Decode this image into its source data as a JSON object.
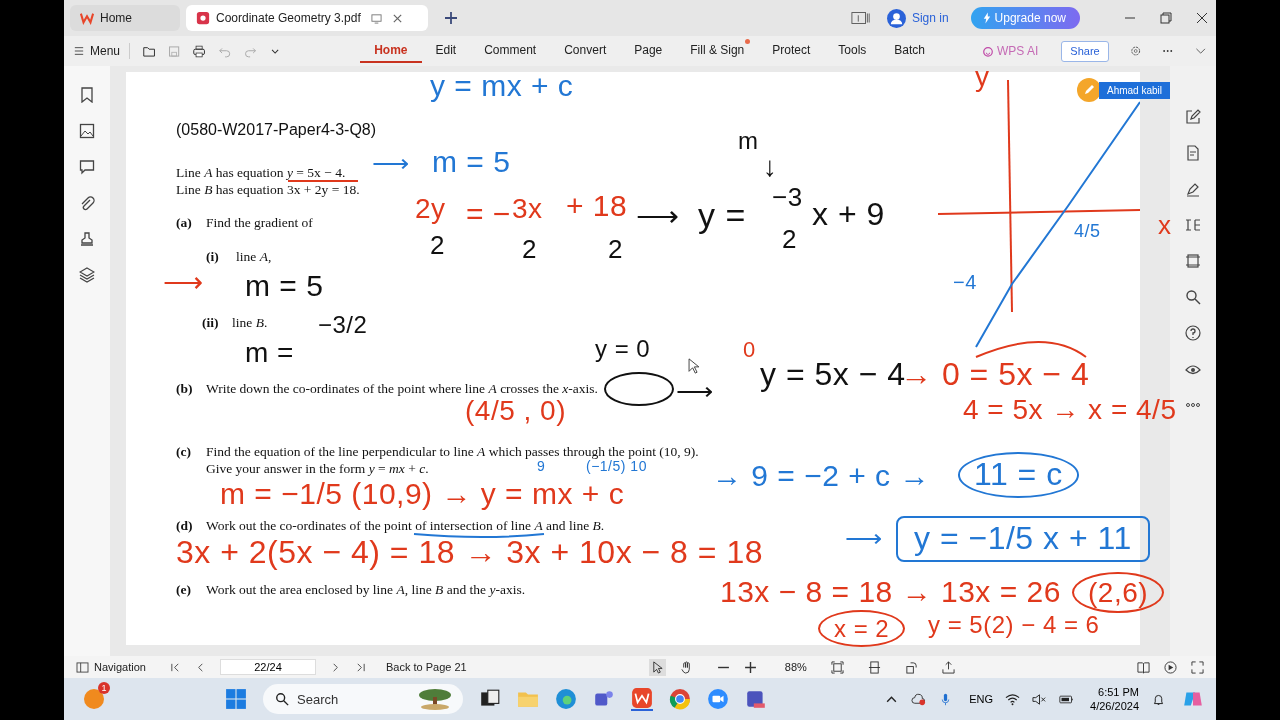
{
  "tabs": [
    {
      "label": "Home",
      "selected": false
    },
    {
      "label": "Coordinate Geometry 3.pdf",
      "selected": true
    }
  ],
  "account": {
    "sign_in": "Sign in",
    "upgrade": "Upgrade now"
  },
  "toolbar": {
    "menu": "Menu",
    "ribbon": [
      {
        "label": "Home",
        "selected": true,
        "dot": false
      },
      {
        "label": "Edit",
        "selected": false,
        "dot": false
      },
      {
        "label": "Comment",
        "selected": false,
        "dot": false
      },
      {
        "label": "Convert",
        "selected": false,
        "dot": false
      },
      {
        "label": "Page",
        "selected": false,
        "dot": false
      },
      {
        "label": "Fill & Sign",
        "selected": false,
        "dot": true
      },
      {
        "label": "Protect",
        "selected": false,
        "dot": false
      },
      {
        "label": "Tools",
        "selected": false,
        "dot": false
      },
      {
        "label": "Batch",
        "selected": false,
        "dot": false
      }
    ],
    "ai": "WPS AI",
    "share": "Share"
  },
  "document": {
    "heading": "(0580-W2017-Paper4-3-Q8)",
    "lines": [
      {
        "text": "Line *A* has equation  *y* = 5x − 4."
      },
      {
        "text": "Line *B* has equation  3x + 2y = 18."
      },
      {
        "label": "(a)",
        "text": "Find the gradient of"
      },
      {
        "label": "(i)",
        "text": "line *A*,"
      },
      {
        "label": "(ii)",
        "text": "line *B*."
      },
      {
        "label": "(b)",
        "text": "Write down the co-ordinates of the point where line *A* crosses the *x*-axis."
      },
      {
        "label": "(c)",
        "text": "Find the equation of the line perpendicular to line *A* which passes through the point (10, 9).\nGive your answer in the form  *y* = *mx* + *c*."
      },
      {
        "label": "(d)",
        "text": "Work out the co-ordinates of the point of intersection of line *A* and line *B*."
      },
      {
        "label": "(e)",
        "text": "Work out the area enclosed by line *A*, line *B* and the *y*-axis."
      }
    ],
    "annotations": [
      {
        "text": "y = mx + c",
        "color": "#2277d4",
        "kind": "plain"
      },
      {
        "text": "y",
        "color": "#e0391c",
        "kind": "plain"
      },
      {
        "text": "m",
        "color": "#111111",
        "kind": "plain"
      },
      {
        "text": "⟶",
        "color": "#2277d4",
        "kind": "plain"
      },
      {
        "text": "m = 5",
        "color": "#2277d4",
        "kind": "plain"
      },
      {
        "text": "↓",
        "color": "#111111",
        "kind": "plain"
      },
      {
        "text": "2y",
        "color": "#e0391c",
        "kind": "plain"
      },
      {
        "text": "= −",
        "color": "#e0391c",
        "kind": "plain"
      },
      {
        "text": "3x",
        "color": "#e0391c",
        "kind": "plain"
      },
      {
        "text": "+ 18",
        "color": "#e0391c",
        "kind": "plain"
      },
      {
        "text": "⟶",
        "color": "#111111",
        "kind": "plain"
      },
      {
        "text": "y =",
        "color": "#111111",
        "kind": "plain"
      },
      {
        "text": "−3",
        "color": "#111111",
        "kind": "plain"
      },
      {
        "text": "x + 9",
        "color": "#111111",
        "kind": "plain"
      },
      {
        "text": "2",
        "color": "#111111",
        "kind": "plain"
      },
      {
        "text": "2",
        "color": "#111111",
        "kind": "plain"
      },
      {
        "text": "2",
        "color": "#111111",
        "kind": "plain"
      },
      {
        "text": "2",
        "color": "#111111",
        "kind": "plain"
      },
      {
        "text": "4/5",
        "color": "#2277d4",
        "kind": "plain"
      },
      {
        "text": "x",
        "color": "#e0391c",
        "kind": "plain"
      },
      {
        "text": "⟶",
        "color": "#e0391c",
        "kind": "plain"
      },
      {
        "text": "m = 5",
        "color": "#111111",
        "kind": "plain"
      },
      {
        "text": "−4",
        "color": "#2277d4",
        "kind": "plain"
      },
      {
        "text": "−3/2",
        "color": "#111111",
        "kind": "plain"
      },
      {
        "text": "m =",
        "color": "#111111",
        "kind": "plain"
      },
      {
        "text": "y = 0",
        "color": "#111111",
        "kind": "plain"
      },
      {
        "text": "0",
        "color": "#e0391c",
        "kind": "plain"
      },
      {
        "text": "⟶",
        "color": "#111111",
        "kind": "plain"
      },
      {
        "text": "y = 5x − 4",
        "color": "#111111",
        "kind": "plain"
      },
      {
        "text": "→ 0 = 5x − 4",
        "color": "#e0391c",
        "kind": "plain"
      },
      {
        "text": "(4/5 , 0)",
        "color": "#e0391c",
        "kind": "plain"
      },
      {
        "text": "4 = 5x → x = 4/5",
        "color": "#e0391c",
        "kind": "plain"
      },
      {
        "text": "9",
        "color": "#2277d4",
        "kind": "plain"
      },
      {
        "text": "(−1/5) 10",
        "color": "#2277d4",
        "kind": "plain"
      },
      {
        "text": "m = −1/5  (10,9) → y = mx + c",
        "color": "#e0391c",
        "kind": "plain"
      },
      {
        "text": "→ 9 = −2 + c →",
        "color": "#2277d4",
        "kind": "plain"
      },
      {
        "text": "11 = c",
        "color": "#2277d4",
        "kind": "circled"
      },
      {
        "text": "⟶",
        "color": "#2277d4",
        "kind": "plain"
      },
      {
        "text": "y = −1/5 x + 11",
        "color": "#2277d4",
        "kind": "boxed"
      },
      {
        "text": "3x + 2(5x − 4) = 18 → 3x + 10x − 8 = 18",
        "color": "#e0391c",
        "kind": "plain"
      },
      {
        "text": "13x − 8 = 18 → 13x = 26",
        "color": "#e0391c",
        "kind": "plain"
      },
      {
        "text": "(2,6)",
        "color": "#e0391c",
        "kind": "circled"
      },
      {
        "text": "x = 2",
        "color": "#e0391c",
        "kind": "circled"
      },
      {
        "text": "y = 5(2) − 4 = 6",
        "color": "#e0391c",
        "kind": "plain"
      }
    ],
    "collaborator": "Ahmad kabil"
  },
  "status_bar": {
    "navigation": "Navigation",
    "page": "22/24",
    "back": "Back to Page 21",
    "zoom": "88%"
  },
  "taskbar": {
    "notification_count": "1",
    "search": "Search",
    "language": "ENG",
    "time": "6:51 PM",
    "date": "4/26/2024"
  }
}
